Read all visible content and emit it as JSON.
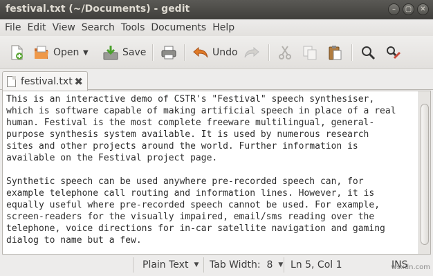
{
  "window": {
    "title": "festival.txt (~/Documents) - gedit"
  },
  "menu": [
    "File",
    "Edit",
    "View",
    "Search",
    "Tools",
    "Documents",
    "Help"
  ],
  "toolbar": {
    "open_label": "Open",
    "save_label": "Save",
    "undo_label": "Undo"
  },
  "tab": {
    "label": "festival.txt"
  },
  "document": {
    "text": "This is an interactive demo of CSTR's \"Festival\" speech synthesiser,\nwhich is software capable of making artificial speech in place of a real\nhuman. Festival is the most complete freeware multilingual, general-\npurpose synthesis system available. It is used by numerous research\nsites and other projects around the world. Further information is\navailable on the Festival project page.\n\nSynthetic speech can be used anywhere pre-recorded speech can, for\nexample telephone call routing and information lines. However, it is\nequally useful where pre-recorded speech cannot be used. For example,\nscreen-readers for the visually impaired, email/sms reading over the\ntelephone, voice directions for in-car satellite navigation and gaming\ndialog to name but a few."
  },
  "statusbar": {
    "language": "Plain Text",
    "tab_width": "Tab Width:  8",
    "position": "Ln 5, Col 1",
    "mode": "INS",
    "watermark": "wsxdn.com"
  }
}
